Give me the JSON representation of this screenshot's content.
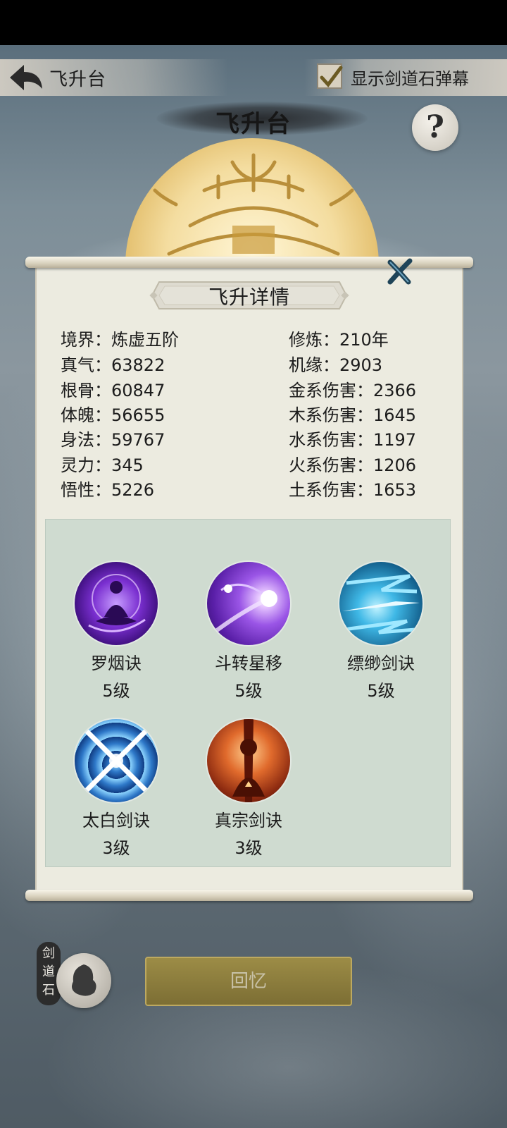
{
  "header": {
    "back_title": "飞升台",
    "danmu_checked": true,
    "danmu_label": "显示剑道石弹幕",
    "main_title": "飞升台",
    "help_label": "?"
  },
  "panel": {
    "title": "飞升详情",
    "left_stats": [
      {
        "label": "境界：",
        "value": "炼虚五阶"
      },
      {
        "label": "真气：",
        "value": "63822"
      },
      {
        "label": "根骨：",
        "value": "60847"
      },
      {
        "label": "体魄：",
        "value": "56655"
      },
      {
        "label": "身法：",
        "value": "59767"
      },
      {
        "label": "灵力：",
        "value": "345"
      },
      {
        "label": "悟性：",
        "value": "5226"
      }
    ],
    "right_stats": [
      {
        "label": "修炼：",
        "value": "210年"
      },
      {
        "label": "机缘：",
        "value": "2903"
      },
      {
        "label": "金系伤害：",
        "value": "2366"
      },
      {
        "label": "木系伤害：",
        "value": "1645"
      },
      {
        "label": "水系伤害：",
        "value": "1197"
      },
      {
        "label": "火系伤害：",
        "value": "1206"
      },
      {
        "label": "土系伤害：",
        "value": "1653"
      }
    ],
    "skills": [
      {
        "name": "罗烟诀",
        "level": "5级",
        "icon": "meditation-purple-icon"
      },
      {
        "name": "斗转星移",
        "level": "5级",
        "icon": "comet-purple-icon"
      },
      {
        "name": "缥缈剑诀",
        "level": "5级",
        "icon": "sword-wind-blue-icon"
      },
      {
        "name": "太白剑诀",
        "level": "3级",
        "icon": "crossed-swords-blue-icon"
      },
      {
        "name": "真宗剑诀",
        "level": "3级",
        "icon": "flame-warrior-icon"
      }
    ]
  },
  "footer": {
    "stone_label": "剑道石",
    "recall_label": "回忆"
  },
  "colors": {
    "panel_bg": "#ecebe0",
    "skills_bg": "#cfdbd0",
    "recall_button": "#8c7d3c"
  }
}
